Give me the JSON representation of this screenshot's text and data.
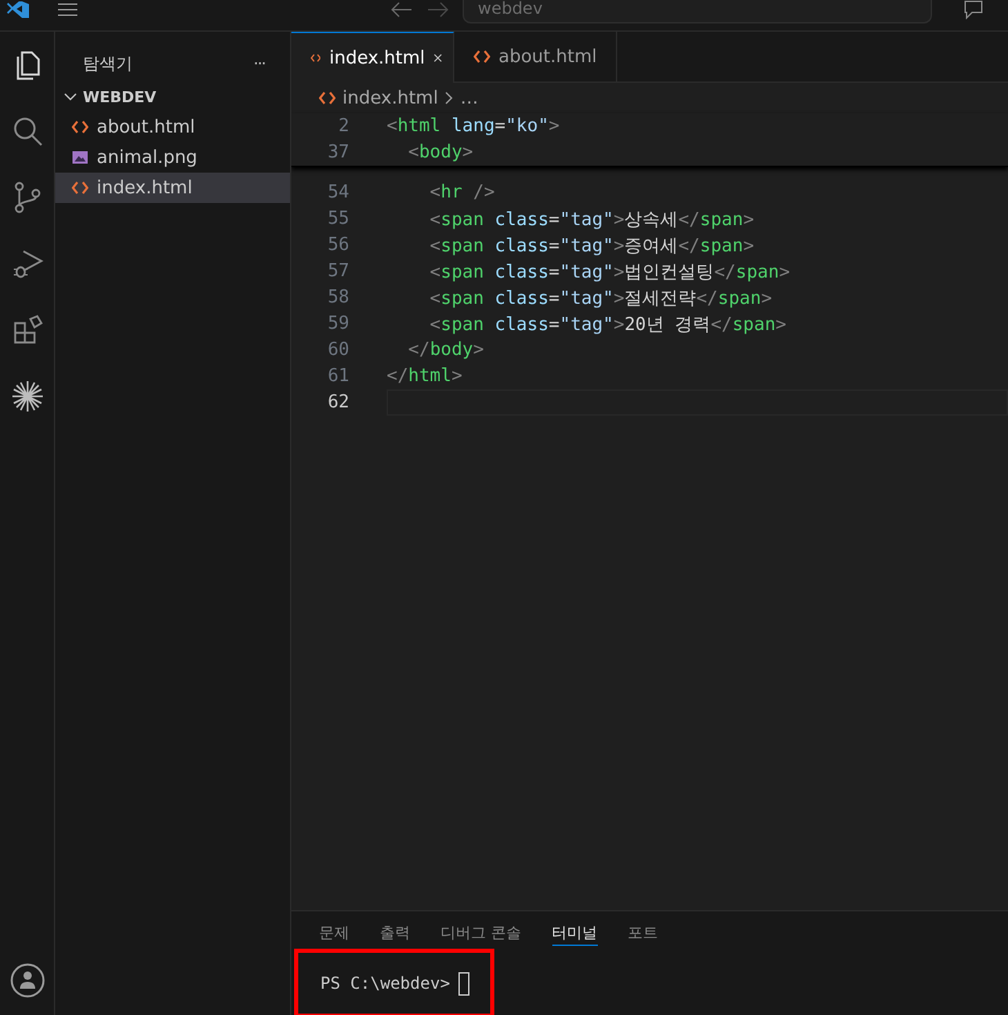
{
  "title_bar": {
    "search_value": "webdev"
  },
  "sidebar": {
    "title": "탐색기",
    "more": "···",
    "folder": {
      "name": "WEBDEV",
      "expanded": true,
      "children": [
        {
          "name": "about.html",
          "kind": "html",
          "selected": false
        },
        {
          "name": "animal.png",
          "kind": "image",
          "selected": false
        },
        {
          "name": "index.html",
          "kind": "html",
          "selected": true
        }
      ]
    }
  },
  "tabs": [
    {
      "label": "index.html",
      "selected": true
    },
    {
      "label": "about.html",
      "selected": false
    }
  ],
  "breadcrumb": [
    "index.html",
    "…"
  ],
  "editor": {
    "sticky_lines": [
      {
        "number": "2",
        "tokens": [
          {
            "text": "<",
            "kind": "punct"
          },
          {
            "text": "html",
            "kind": "tag"
          },
          {
            "text": " lang",
            "kind": "attr"
          },
          {
            "text": "=",
            "kind": "text"
          },
          {
            "text": "\"ko\"",
            "kind": "string"
          },
          {
            "text": ">",
            "kind": "punct"
          }
        ]
      },
      {
        "number": "37",
        "tokens": [
          {
            "text": "  <",
            "kind": "punct"
          },
          {
            "text": "body",
            "kind": "tag"
          },
          {
            "text": ">",
            "kind": "punct"
          }
        ]
      }
    ],
    "lines": [
      {
        "number": "54",
        "selected": false,
        "tokens": [
          {
            "text": "    <",
            "kind": "punct"
          },
          {
            "text": "hr",
            "kind": "tag"
          },
          {
            "text": " />",
            "kind": "punct"
          }
        ]
      },
      {
        "number": "55",
        "selected": false,
        "tokens": [
          {
            "text": "    <",
            "kind": "punct"
          },
          {
            "text": "span",
            "kind": "tag"
          },
          {
            "text": " class",
            "kind": "attr"
          },
          {
            "text": "=",
            "kind": "text"
          },
          {
            "text": "\"tag\"",
            "kind": "string"
          },
          {
            "text": ">",
            "kind": "punct"
          },
          {
            "text": "상속세",
            "kind": "text"
          },
          {
            "text": "</",
            "kind": "punct"
          },
          {
            "text": "span",
            "kind": "tag"
          },
          {
            "text": ">",
            "kind": "punct"
          }
        ]
      },
      {
        "number": "56",
        "selected": false,
        "tokens": [
          {
            "text": "    <",
            "kind": "punct"
          },
          {
            "text": "span",
            "kind": "tag"
          },
          {
            "text": " class",
            "kind": "attr"
          },
          {
            "text": "=",
            "kind": "text"
          },
          {
            "text": "\"tag\"",
            "kind": "string"
          },
          {
            "text": ">",
            "kind": "punct"
          },
          {
            "text": "증여세",
            "kind": "text"
          },
          {
            "text": "</",
            "kind": "punct"
          },
          {
            "text": "span",
            "kind": "tag"
          },
          {
            "text": ">",
            "kind": "punct"
          }
        ]
      },
      {
        "number": "57",
        "selected": false,
        "tokens": [
          {
            "text": "    <",
            "kind": "punct"
          },
          {
            "text": "span",
            "kind": "tag"
          },
          {
            "text": " class",
            "kind": "attr"
          },
          {
            "text": "=",
            "kind": "text"
          },
          {
            "text": "\"tag\"",
            "kind": "string"
          },
          {
            "text": ">",
            "kind": "punct"
          },
          {
            "text": "법인컨설팅",
            "kind": "text"
          },
          {
            "text": "</",
            "kind": "punct"
          },
          {
            "text": "span",
            "kind": "tag"
          },
          {
            "text": ">",
            "kind": "punct"
          }
        ]
      },
      {
        "number": "58",
        "selected": false,
        "tokens": [
          {
            "text": "    <",
            "kind": "punct"
          },
          {
            "text": "span",
            "kind": "tag"
          },
          {
            "text": " class",
            "kind": "attr"
          },
          {
            "text": "=",
            "kind": "text"
          },
          {
            "text": "\"tag\"",
            "kind": "string"
          },
          {
            "text": ">",
            "kind": "punct"
          },
          {
            "text": "절세전략",
            "kind": "text"
          },
          {
            "text": "</",
            "kind": "punct"
          },
          {
            "text": "span",
            "kind": "tag"
          },
          {
            "text": ">",
            "kind": "punct"
          }
        ]
      },
      {
        "number": "59",
        "selected": false,
        "tokens": [
          {
            "text": "    <",
            "kind": "punct"
          },
          {
            "text": "span",
            "kind": "tag"
          },
          {
            "text": " class",
            "kind": "attr"
          },
          {
            "text": "=",
            "kind": "text"
          },
          {
            "text": "\"tag\"",
            "kind": "string"
          },
          {
            "text": ">",
            "kind": "punct"
          },
          {
            "text": "20년 경력",
            "kind": "text"
          },
          {
            "text": "</",
            "kind": "punct"
          },
          {
            "text": "span",
            "kind": "tag"
          },
          {
            "text": ">",
            "kind": "punct"
          }
        ]
      },
      {
        "number": "60",
        "selected": false,
        "tokens": [
          {
            "text": "  </",
            "kind": "punct"
          },
          {
            "text": "body",
            "kind": "tag"
          },
          {
            "text": ">",
            "kind": "punct"
          }
        ]
      },
      {
        "number": "61",
        "selected": false,
        "tokens": [
          {
            "text": "</",
            "kind": "punct"
          },
          {
            "text": "html",
            "kind": "tag"
          },
          {
            "text": ">",
            "kind": "punct"
          }
        ]
      },
      {
        "number": "62",
        "selected": true
      }
    ]
  },
  "panel": {
    "tabs": [
      {
        "label": "문제",
        "selected": false
      },
      {
        "label": "출력",
        "selected": false
      },
      {
        "label": "디버그 콘솔",
        "selected": false
      },
      {
        "label": "터미널",
        "selected": true
      },
      {
        "label": "포트",
        "selected": false
      }
    ],
    "terminal": {
      "prompt": "PS C:\\webdev>",
      "highlighted": true
    }
  }
}
